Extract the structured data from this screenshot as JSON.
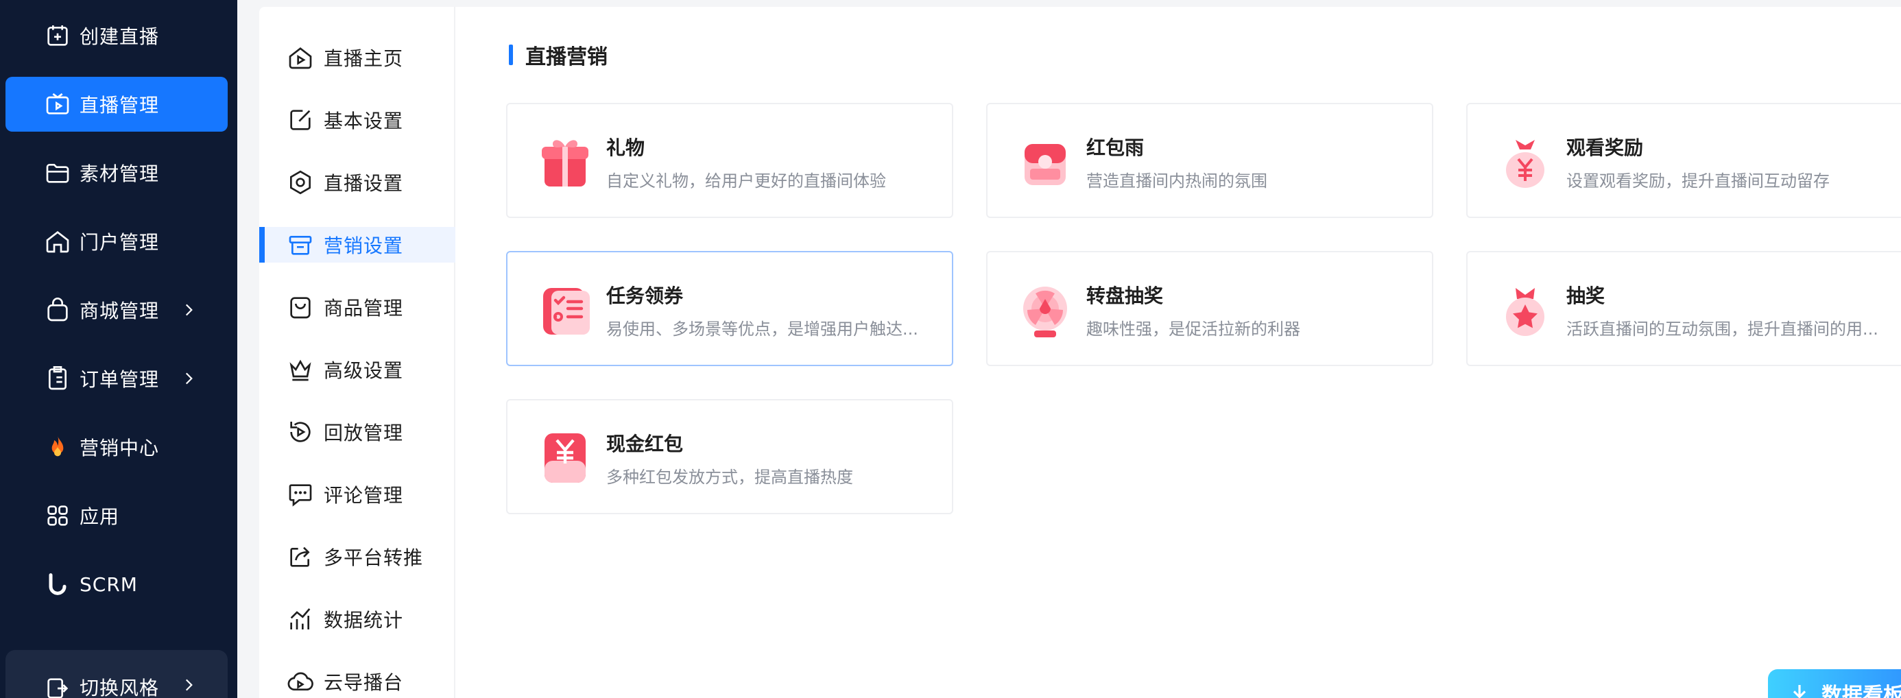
{
  "sidebar": {
    "items": [
      {
        "label": "创建直播",
        "icon": "calendar-plus-icon"
      },
      {
        "label": "直播管理",
        "icon": "tv-icon",
        "active": true
      },
      {
        "label": "素材管理",
        "icon": "folder-icon"
      },
      {
        "label": "门户管理",
        "icon": "home-icon"
      },
      {
        "label": "商城管理",
        "icon": "shopping-bag-icon"
      },
      {
        "label": "订单管理",
        "icon": "clipboard-icon"
      },
      {
        "label": "营销中心",
        "icon": "fire-icon"
      },
      {
        "label": "应用",
        "icon": "apps-icon"
      },
      {
        "label": "SCRM",
        "icon": "scrm-logo-icon"
      }
    ],
    "switch_style": "切换风格"
  },
  "submenu": {
    "items": [
      {
        "label": "直播主页",
        "icon": "play-home-icon"
      },
      {
        "label": "基本设置",
        "icon": "edit-icon"
      },
      {
        "label": "直播设置",
        "icon": "settings-icon"
      },
      {
        "label": "营销设置",
        "icon": "gift-box-icon",
        "active": true
      },
      {
        "label": "商品管理",
        "icon": "bag-icon"
      },
      {
        "label": "高级设置",
        "icon": "crown-icon"
      },
      {
        "label": "回放管理",
        "icon": "replay-icon"
      },
      {
        "label": "评论管理",
        "icon": "comment-icon"
      },
      {
        "label": "多平台转推",
        "icon": "share-icon"
      },
      {
        "label": "数据统计",
        "icon": "stats-icon"
      },
      {
        "label": "云导播台",
        "icon": "cloud-icon"
      }
    ]
  },
  "content": {
    "section_title": "直播营销",
    "cards": [
      {
        "title": "礼物",
        "desc": "自定义礼物，给用户更好的直播间体验",
        "icon": "gift-icon"
      },
      {
        "title": "红包雨",
        "desc": "营造直播间内热闹的氛围",
        "icon": "red-envelope-rain-icon"
      },
      {
        "title": "观看奖励",
        "desc": "设置观看奖励，提升直播间互动留存",
        "icon": "money-bag-icon"
      },
      {
        "title": "任务领券",
        "desc": "易使用、多场景等优点，是增强用户触达...",
        "icon": "task-coupon-icon"
      },
      {
        "title": "转盘抽奖",
        "desc": "趣味性强，是促活拉新的利器",
        "icon": "lucky-wheel-icon"
      },
      {
        "title": "抽奖",
        "desc": "活跃直播间的互动氛围，提升直播间的用...",
        "icon": "lottery-icon"
      },
      {
        "title": "现金红包",
        "desc": "多种红包发放方式，提高直播热度",
        "icon": "cash-red-packet-icon"
      }
    ]
  },
  "data_button": {
    "label": "数据看板"
  },
  "colors": {
    "sidebar_bg": "#0e1a33",
    "accent": "#1677ff",
    "card_icon": "#f4475f"
  }
}
